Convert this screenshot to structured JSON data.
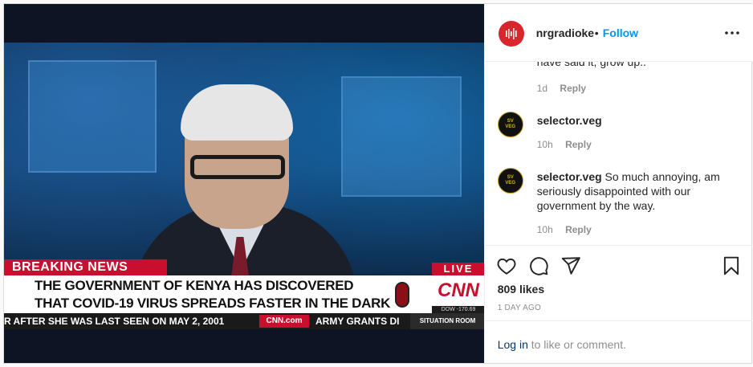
{
  "media": {
    "breaking": "BREAKING NEWS",
    "headline_line1": "THE GOVERNMENT OF KENYA HAS DISCOVERED",
    "headline_line2": "THAT COVID-19 VIRUS  SPREADS FASTER IN THE DARK",
    "live": "LIVE",
    "network": "CNN",
    "dow": "DOW  -170.69",
    "ticker_left": "R AFTER SHE WAS LAST SEEN ON MAY 2, 2001",
    "ticker_site": "CNN.com",
    "ticker_right": "ARMY GRANTS DI",
    "situation": "SITUATION ROOM"
  },
  "header": {
    "username": "nrgradioke",
    "dot": "•",
    "follow": "Follow",
    "more_icon": "more-horizontal-icon"
  },
  "comments": {
    "cut_text": "have said it, grow up..",
    "first_meta": {
      "time": "1d",
      "reply": "Reply"
    },
    "items": [
      {
        "user": "selector.veg",
        "text": "   ",
        "time": "10h",
        "reply": "Reply"
      },
      {
        "user": "selector.veg",
        "text": "So much annoying, am seriously disappointed with our government by the way.",
        "time": "10h",
        "reply": "Reply"
      }
    ]
  },
  "actions": {
    "icons": [
      "heart-icon",
      "comment-icon",
      "share-icon",
      "bookmark-icon"
    ],
    "likes": "809 likes",
    "posted": "1 DAY AGO"
  },
  "login": {
    "link": "Log in",
    "rest": "to like or comment."
  },
  "colors": {
    "follow_blue": "#0095f6",
    "brand_red": "#d7262e",
    "cnn_red": "#c8102e"
  }
}
